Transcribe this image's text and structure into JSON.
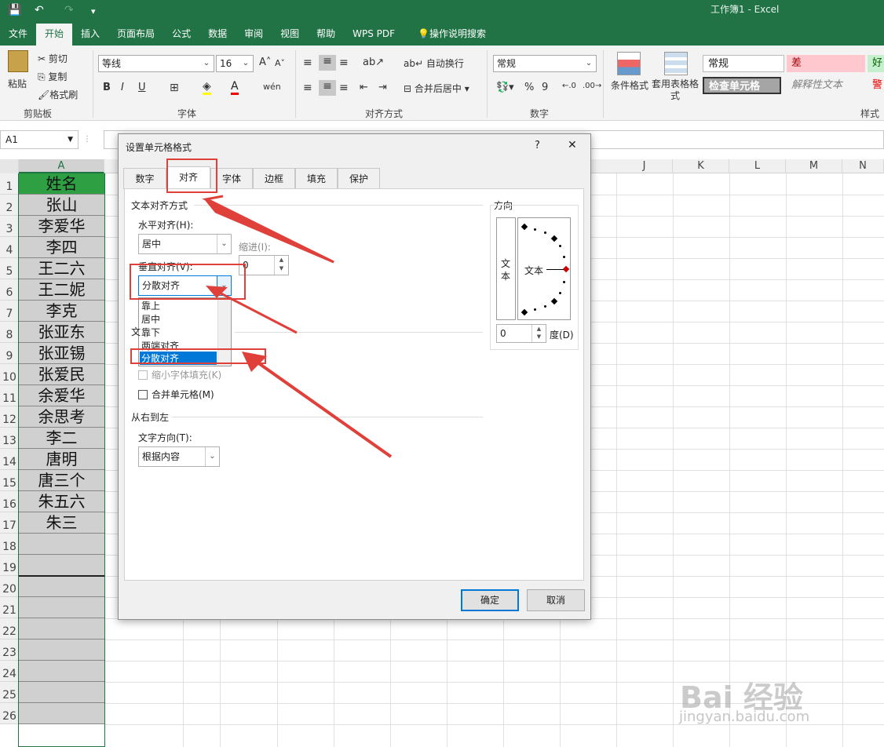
{
  "window": {
    "title": "工作簿1  -  Excel"
  },
  "quick_access": {
    "save": "💾",
    "undo": "↶",
    "redo": "↷",
    "customize": "▾"
  },
  "ribbon_tabs": [
    "文件",
    "开始",
    "插入",
    "页面布局",
    "公式",
    "数据",
    "审阅",
    "视图",
    "帮助",
    "WPS PDF",
    "操作说明搜索"
  ],
  "active_tab": "开始",
  "clipboard": {
    "paste": "粘贴",
    "cut": "剪切",
    "copy": "复制",
    "format_painter": "格式刷",
    "label": "剪贴板"
  },
  "font": {
    "name": "等线",
    "size": "16",
    "bold": "B",
    "italic": "I",
    "underline": "U",
    "label": "字体"
  },
  "alignment": {
    "wrap": "自动换行",
    "merge": "合并后居中",
    "label": "对齐方式"
  },
  "number": {
    "format": "常规",
    "percent": "%",
    "comma": "9",
    "label": "数字"
  },
  "styles_group": {
    "conditional": "条件格式",
    "table_format": "套用表格格式",
    "label": "样式",
    "cells": [
      "常规",
      "差",
      "好",
      "检查单元格",
      "解释性文本",
      "警"
    ]
  },
  "name_box": "A1",
  "columns": [
    "A",
    "J",
    "K",
    "L",
    "M",
    "N"
  ],
  "rows": [
    "1",
    "2",
    "3",
    "4",
    "5",
    "6",
    "7",
    "8",
    "9",
    "10",
    "11",
    "12",
    "13",
    "14",
    "15",
    "16",
    "17",
    "18",
    "19",
    "20",
    "21",
    "22",
    "23",
    "24",
    "25",
    "26"
  ],
  "col_a_values": [
    "姓名",
    "张山",
    "李爱华",
    "李四",
    "王二六",
    "王二妮",
    "李克",
    "张亚东",
    "张亚锡",
    "张爱民",
    "余爱华",
    "余思考",
    "李二",
    "唐明",
    "唐三个",
    "朱五六",
    "朱三",
    "",
    "",
    "",
    "",
    "",
    "",
    "",
    "",
    ""
  ],
  "dialog": {
    "title": "设置单元格格式",
    "help": "?",
    "close": "✕",
    "tabs": [
      "数字",
      "对齐",
      "字体",
      "边框",
      "填充",
      "保护"
    ],
    "active_tab": "对齐",
    "section_text_align": "文本对齐方式",
    "horizontal_label": "水平对齐(H):",
    "horizontal_value": "居中",
    "indent_label": "缩进(I):",
    "indent_value": "0",
    "vertical_label": "垂直对齐(V):",
    "vertical_value": "分散对齐",
    "vertical_options": [
      "靠上",
      "居中",
      "靠下",
      "两端对齐",
      "分散对齐"
    ],
    "text_control_label": "文",
    "shrink_label": "缩小字体填充(K)",
    "merge_label": "合并单元格(M)",
    "rtl_section": "从右到左",
    "direction_label": "文字方向(T):",
    "direction_value": "根据内容",
    "orientation_section": "方向",
    "vertical_text": "文本",
    "orient_text": "文本",
    "degree_value": "0",
    "degree_label": "度(D)",
    "ok": "确定",
    "cancel": "取消"
  },
  "watermark": {
    "brand": "Bai 经验",
    "url": "jingyan.baidu.com"
  },
  "colors": {
    "excel_green": "#217346",
    "highlight": "#0078d7",
    "annotation_red": "#e0403a"
  }
}
